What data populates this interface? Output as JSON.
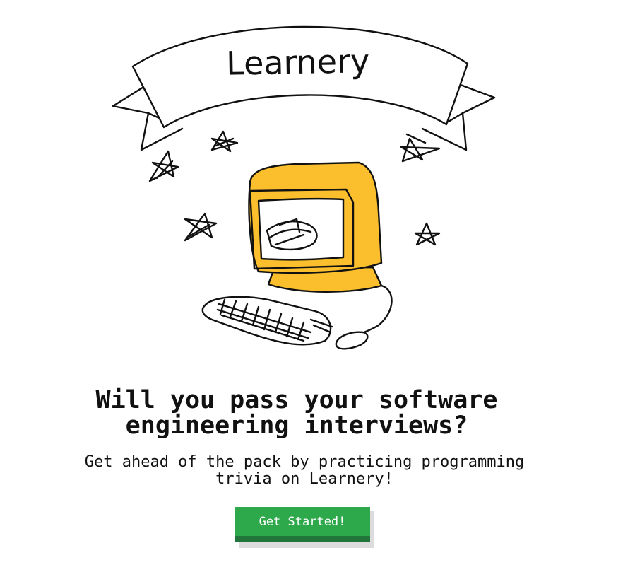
{
  "brand": {
    "banner_text": "Learnery",
    "illustration": "computer-with-stars-sketch",
    "accent_color": "#fbbf2e"
  },
  "hero": {
    "headline_line1": "Will you pass your software",
    "headline_line2": "engineering interviews?",
    "subhead_line1": "Get ahead of the pack by practicing programming",
    "subhead_line2": "trivia on Learnery!"
  },
  "cta": {
    "label": "Get Started!",
    "color": "#2da84b",
    "shadow_color": "#21743a"
  }
}
